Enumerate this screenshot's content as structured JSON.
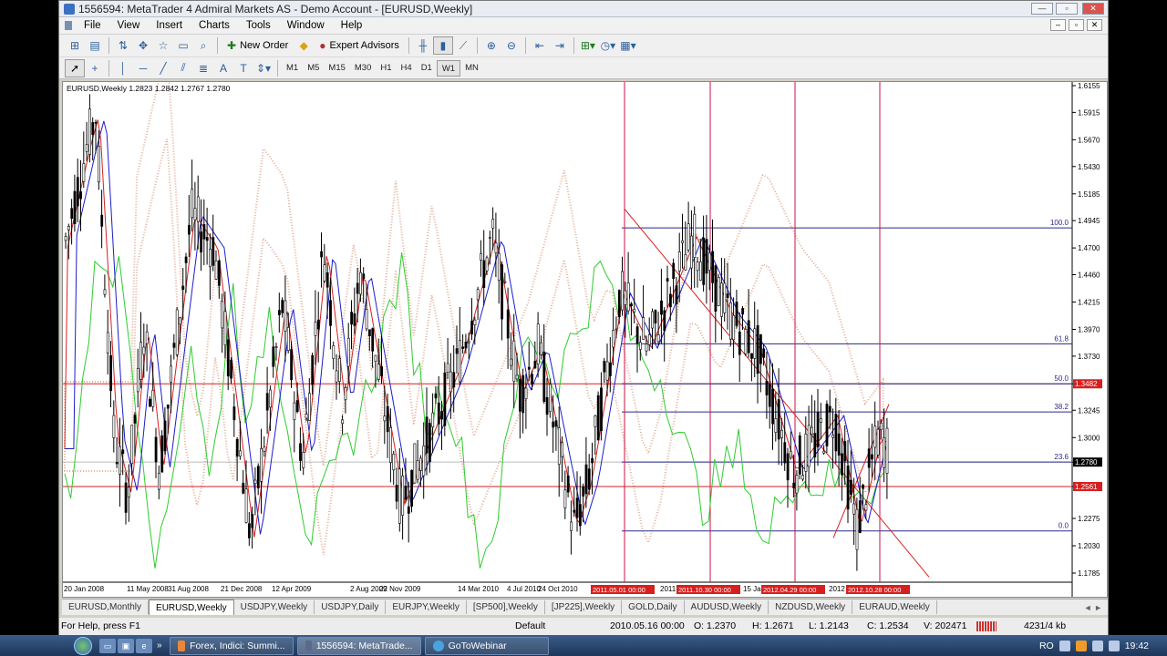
{
  "window": {
    "title": "1556594: MetaTrader 4 Admiral Markets AS - Demo Account - [EURUSD,Weekly]",
    "buttons": [
      "—",
      "▫",
      "✕"
    ]
  },
  "menu": {
    "items": [
      "File",
      "View",
      "Insert",
      "Charts",
      "Tools",
      "Window",
      "Help"
    ],
    "mdi_buttons": [
      "–",
      "▫",
      "✕"
    ]
  },
  "toolbar": {
    "new_order": "New Order",
    "expert_advisors": "Expert Advisors",
    "timeframes": [
      "M1",
      "M5",
      "M15",
      "M30",
      "H1",
      "H4",
      "D1",
      "W1",
      "MN"
    ],
    "active_timeframe": "W1",
    "icons": [
      "new-chart-icon",
      "profiles-icon",
      "market-watch-icon",
      "navigator-icon",
      "data-window-icon",
      "terminal-icon",
      "strategy-tester-icon"
    ]
  },
  "chart": {
    "symbol_info": "EURUSD,Weekly  1.2823 1.2842 1.2767 1.2780",
    "y_ticks": [
      "1.6155",
      "1.5915",
      "1.5670",
      "1.5430",
      "1.5185",
      "1.4945",
      "1.4700",
      "1.4460",
      "1.4215",
      "1.3970",
      "1.3730",
      "1.3482",
      "1.3245",
      "1.3000",
      "1.2780",
      "1.2561",
      "1.2275",
      "1.2030",
      "1.1785"
    ],
    "highlight_labels": [
      {
        "text": "1.3482",
        "color": "#d62020"
      },
      {
        "text": "1.2780",
        "color": "#000000"
      },
      {
        "text": "1.2561",
        "color": "#d62020"
      }
    ],
    "x_ticks": [
      "20 Jan 2008",
      "11 May 2008",
      "31 Aug 2008",
      "21 Dec 2008",
      "12 Apr 2009",
      "2 Aug 2009",
      "22 Nov 2009",
      "14 Mar 2010",
      "4 Jul 2010",
      "24 Oct 2010"
    ],
    "x_tail_ticks": [
      "2011",
      "15 Ja",
      "2012"
    ],
    "vline_labels": [
      "2011.05.01 00:00",
      "2011.10.30 00:00",
      "2012.04.29 00:00",
      "2012.10.28 00:00"
    ],
    "fib_levels": [
      "100.0",
      "61.8",
      "50.0",
      "38.2",
      "23.6",
      "0.0"
    ],
    "colors": {
      "bull": "#000000",
      "bear": "#000000",
      "tenkan": "#d62020",
      "kijun": "#1c1ccc",
      "chikou": "#2ecc2e",
      "cloud": "#d98b6b",
      "cloud2": "#c9a6e8",
      "fib": "#2a2a8a",
      "vline": "#cc1144"
    }
  },
  "tabs": {
    "items": [
      "EURUSD,Monthly",
      "EURUSD,Weekly",
      "USDJPY,Weekly",
      "USDJPY,Daily",
      "EURJPY,Weekly",
      "[SP500],Weekly",
      "[JP225],Weekly",
      "GOLD,Daily",
      "AUDUSD,Weekly",
      "NZDUSD,Weekly",
      "EURAUD,Weekly"
    ],
    "active": "EURUSD,Weekly",
    "arrows": "◄ ►"
  },
  "status": {
    "help": "For Help, press F1",
    "profile": "Default",
    "datetime": "2010.05.16 00:00",
    "open": "O: 1.2370",
    "high": "H: 1.2671",
    "low": "L: 1.2143",
    "close": "C: 1.2534",
    "volume": "V: 202471",
    "traffic": "4231/4 kb"
  },
  "taskbar": {
    "tasks": [
      "Forex, Indici: Summi...",
      "1556594: MetaTrade...",
      "GoToWebinar"
    ],
    "lang": "RO",
    "time": "19:42"
  }
}
